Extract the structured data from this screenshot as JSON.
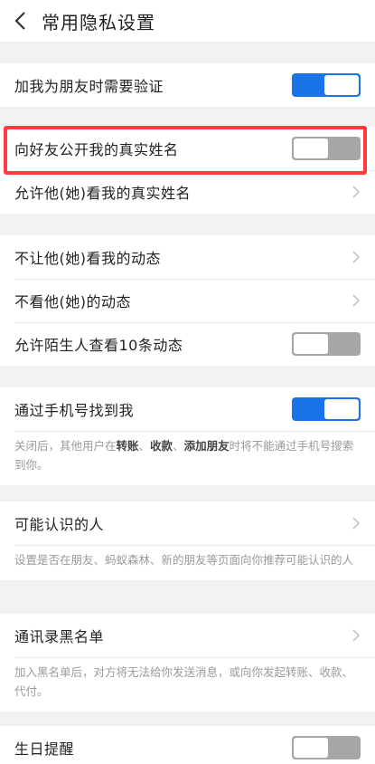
{
  "header": {
    "title": "常用隐私设置"
  },
  "colors": {
    "accent": "#1a73e8",
    "highlight": "#ff3b3b",
    "toggle_off": "#a6a6a6"
  },
  "group1": {
    "verify_friend": {
      "label": "加我为朋友时需要验证",
      "state": "on"
    }
  },
  "group2": {
    "show_real_name": {
      "label": "向好友公开我的真实姓名",
      "state": "off"
    },
    "allow_view_name": {
      "label": "允许他(她)看我的真实姓名"
    }
  },
  "group3": {
    "hide_my_feed": {
      "label": "不让他(她)看我的动态"
    },
    "hide_their_feed": {
      "label": "不看他(她)的动态"
    },
    "stranger_10": {
      "label": "允许陌生人查看10条动态",
      "state": "off"
    }
  },
  "group4": {
    "find_by_phone": {
      "label": "通过手机号找到我",
      "state": "on"
    },
    "note": {
      "part1": "关闭后，其他用户在",
      "bold1": "转账",
      "sep1": "、",
      "bold2": "收款",
      "sep2": "、",
      "bold3": "添加朋友",
      "part2": "时将不能通过手机号搜索到你。"
    }
  },
  "group5": {
    "people_may_know": {
      "label": "可能认识的人"
    },
    "note": "设置是否在朋友、蚂蚁森林、新的朋友等页面向你推荐可能认识的人"
  },
  "group6": {
    "blacklist": {
      "label": "通讯录黑名单"
    },
    "note": "加入黑名单后，对方将无法给你发送消息，或向你发起转账、收款、代付。"
  },
  "group7": {
    "birthday": {
      "label": "生日提醒",
      "state": "off"
    }
  }
}
